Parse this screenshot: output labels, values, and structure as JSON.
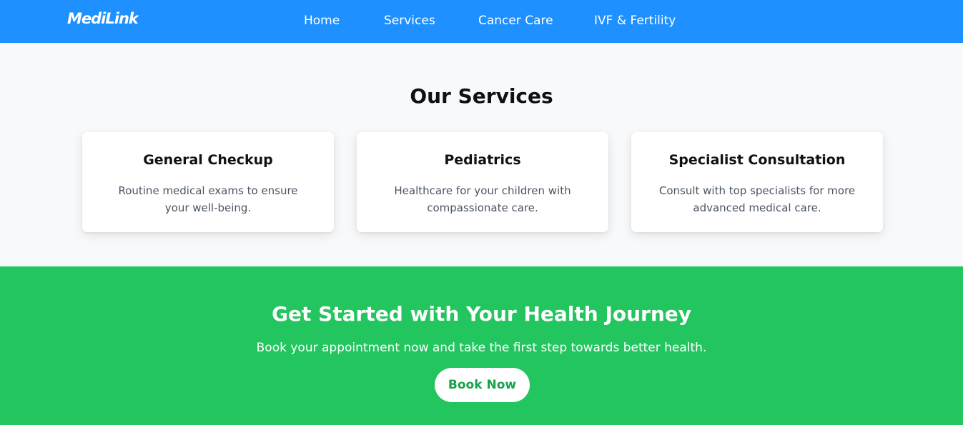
{
  "navbar": {
    "logo": "MediLink",
    "links": [
      {
        "label": "Home"
      },
      {
        "label": "Services"
      },
      {
        "label": "Cancer Care"
      },
      {
        "label": "IVF & Fertility"
      }
    ],
    "background_color": "#1e90ff"
  },
  "services": {
    "title": "Our Services",
    "cards": [
      {
        "title": "General Checkup",
        "description": "Routine medical exams to ensure your well-being."
      },
      {
        "title": "Pediatrics",
        "description": "Healthcare for your children with compassionate care."
      },
      {
        "title": "Specialist Consultation",
        "description": "Consult with top specialists for more advanced medical care."
      }
    ]
  },
  "cta": {
    "title": "Get Started with Your Health Journey",
    "description": "Book your appointment now and take the first step towards better health.",
    "button_label": "Book Now",
    "background_color": "#22c55e"
  }
}
